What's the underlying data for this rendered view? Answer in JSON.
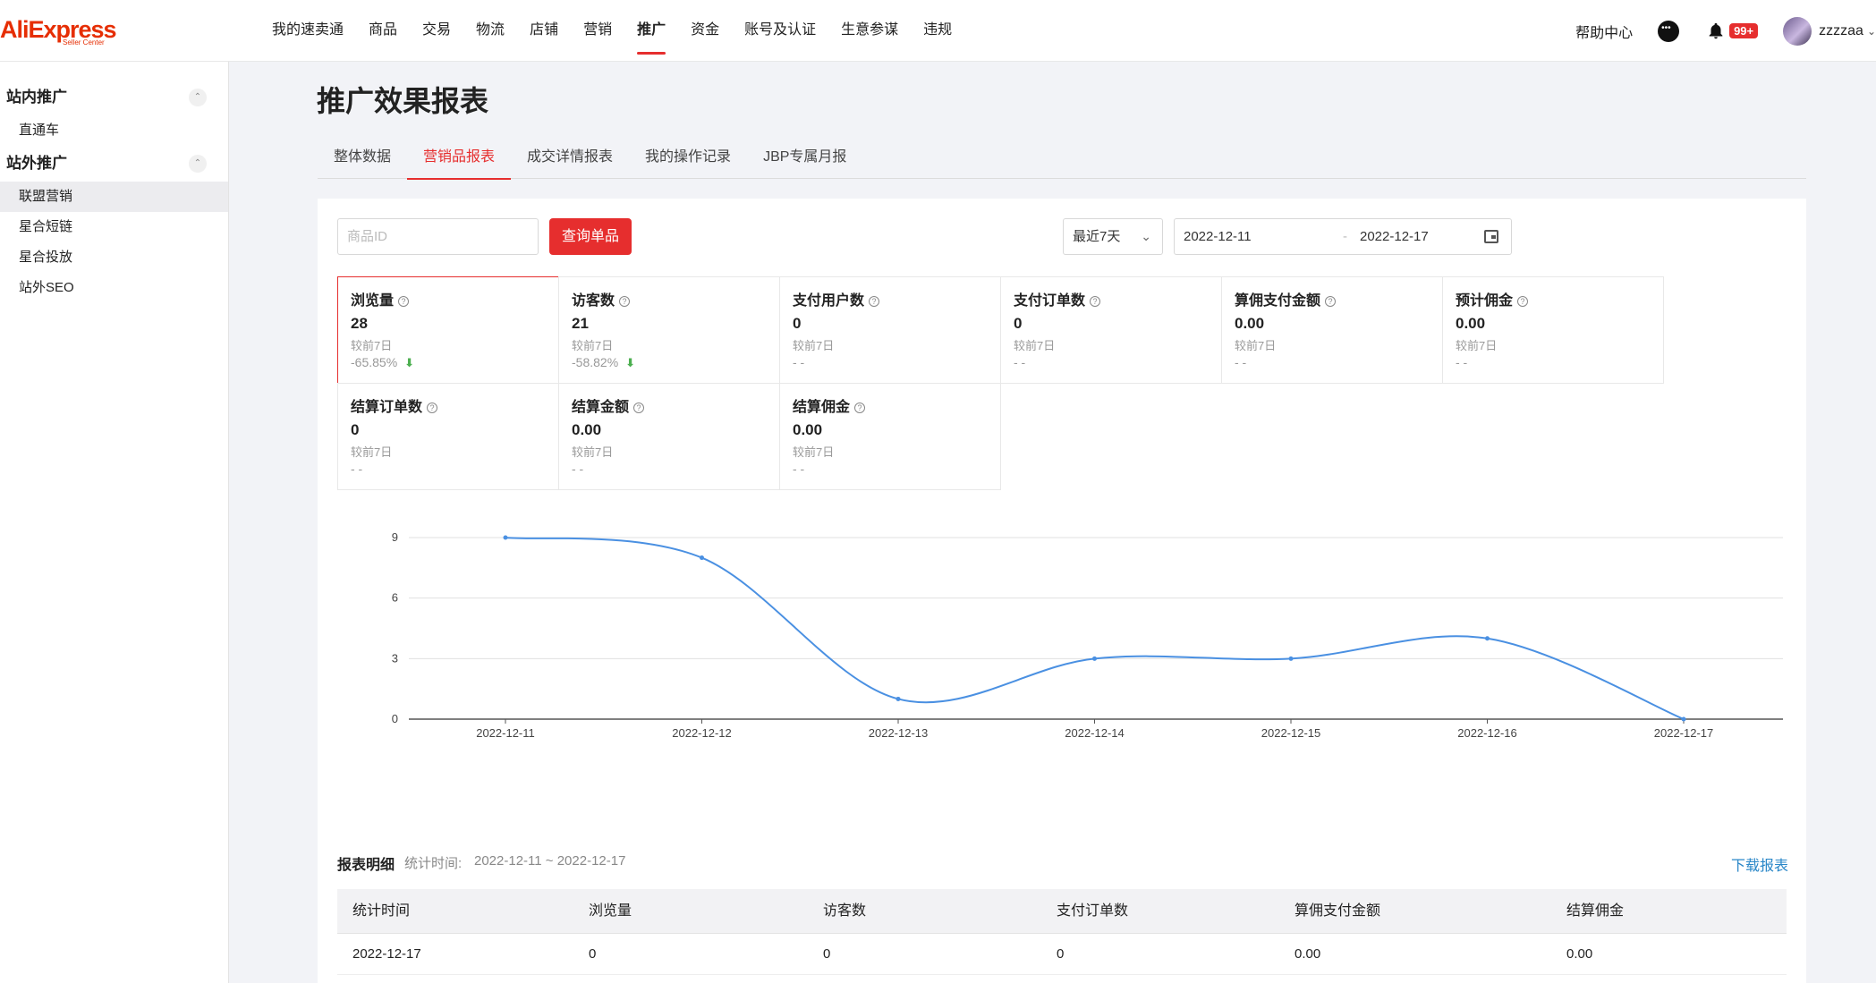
{
  "app": {
    "logo_text": "AliExpress",
    "logo_sub": "Seller Center",
    "brand_color": "#e62e04",
    "accent": "#e62e2e"
  },
  "nav": {
    "items": [
      "我的速卖通",
      "商品",
      "交易",
      "物流",
      "店铺",
      "营销",
      "推广",
      "资金",
      "账号及认证",
      "生意参谋",
      "违规"
    ],
    "active": "推广"
  },
  "top_right": {
    "help": "帮助中心",
    "notification_count": "99+",
    "username": "zzzzaa"
  },
  "sidebar": {
    "groups": [
      {
        "title": "站内推广",
        "items": [
          "直通车"
        ]
      },
      {
        "title": "站外推广",
        "items": [
          "联盟营销",
          "星合短链",
          "星合投放",
          "站外SEO"
        ]
      }
    ],
    "active_item": "联盟营销"
  },
  "page": {
    "title": "推广效果报表",
    "tabs": [
      "整体数据",
      "营销品报表",
      "成交详情报表",
      "我的操作记录",
      "JBP专属月报"
    ],
    "active_tab": "营销品报表"
  },
  "filters": {
    "product_id_placeholder": "商品ID",
    "query_button": "查询单品",
    "range_label": "最近7天",
    "date_start": "2022-12-11",
    "date_sep": "-",
    "date_end": "2022-12-17"
  },
  "metrics": [
    {
      "label": "浏览量",
      "value": "28",
      "compare": "较前7日",
      "delta": "-65.85%",
      "trend": "down",
      "selected": true
    },
    {
      "label": "访客数",
      "value": "21",
      "compare": "较前7日",
      "delta": "-58.82%",
      "trend": "down"
    },
    {
      "label": "支付用户数",
      "value": "0",
      "compare": "较前7日",
      "delta": "- -"
    },
    {
      "label": "支付订单数",
      "value": "0",
      "compare": "较前7日",
      "delta": "- -"
    },
    {
      "label": "算佣支付金额",
      "value": "0.00",
      "compare": "较前7日",
      "delta": "- -"
    },
    {
      "label": "预计佣金",
      "value": "0.00",
      "compare": "较前7日",
      "delta": "- -"
    },
    {
      "label": "结算订单数",
      "value": "0",
      "compare": "较前7日",
      "delta": "- -"
    },
    {
      "label": "结算金额",
      "value": "0.00",
      "compare": "较前7日",
      "delta": "- -"
    },
    {
      "label": "结算佣金",
      "value": "0.00",
      "compare": "较前7日",
      "delta": "- -"
    }
  ],
  "chart_data": {
    "type": "line",
    "x": [
      "2022-12-11",
      "2022-12-12",
      "2022-12-13",
      "2022-12-14",
      "2022-12-15",
      "2022-12-16",
      "2022-12-17"
    ],
    "series": [
      {
        "values": [
          9,
          8,
          1,
          3,
          3,
          4,
          0
        ],
        "color": "#4a90e2"
      }
    ],
    "ylim": [
      0,
      9
    ],
    "yticks": [
      0,
      3,
      6,
      9
    ],
    "smooth": true,
    "grid": true
  },
  "detail": {
    "title": "报表明细",
    "range_label": "统计时间:",
    "range": "2022-12-11 ~ 2022-12-17",
    "download": "下载报表",
    "columns": [
      "统计时间",
      "浏览量",
      "访客数",
      "支付订单数",
      "算佣支付金额",
      "结算佣金"
    ],
    "rows": [
      [
        "2022-12-17",
        "0",
        "0",
        "0",
        "0.00",
        "0.00"
      ]
    ]
  }
}
